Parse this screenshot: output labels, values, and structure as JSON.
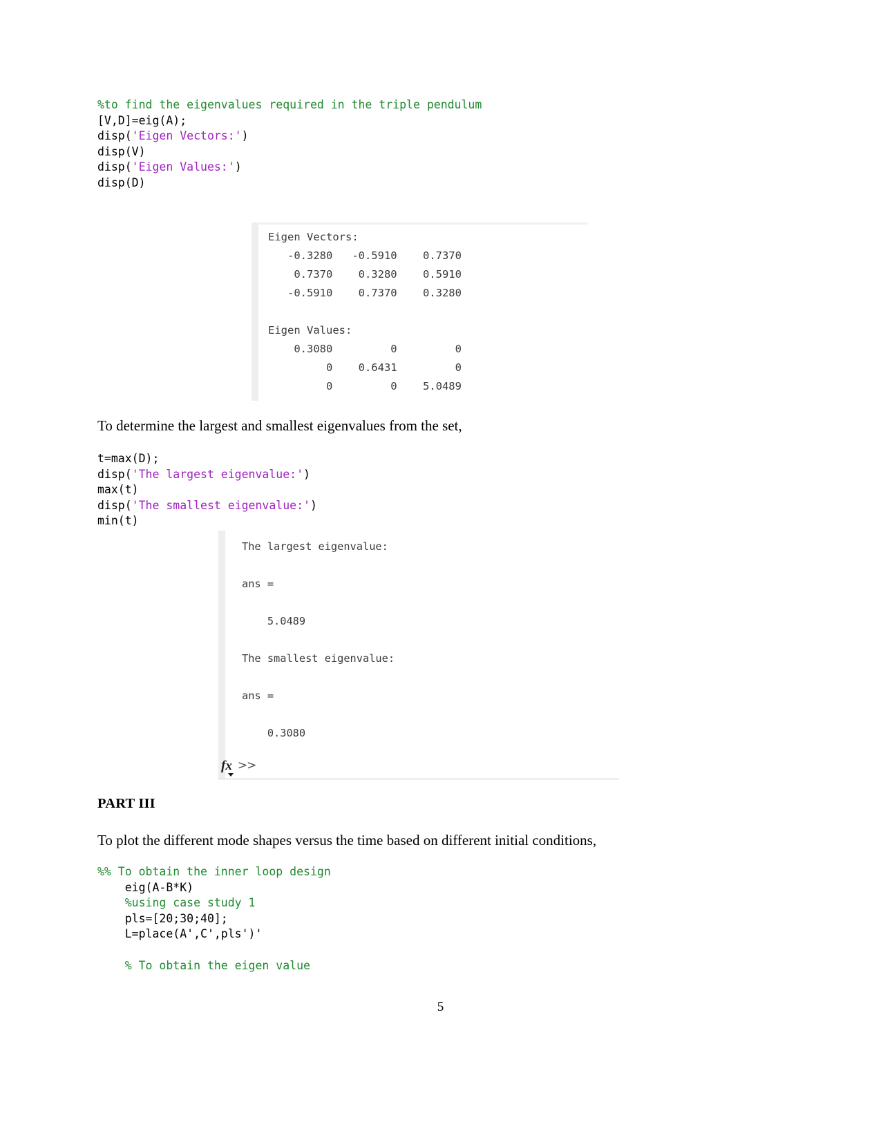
{
  "document": {
    "page_number": "5",
    "section_heading": "PART III"
  },
  "code_block_1": {
    "name": "matlab-eig-code",
    "lines": [
      {
        "segments": [
          {
            "kind": "cmt",
            "text": "%to find the eigenvalues required in the triple pendulum"
          }
        ]
      },
      {
        "segments": [
          {
            "kind": "pln",
            "text": "[V,D]=eig(A);"
          }
        ]
      },
      {
        "segments": [
          {
            "kind": "pln",
            "text": "disp("
          },
          {
            "kind": "str",
            "text": "'Eigen Vectors:'"
          },
          {
            "kind": "pln",
            "text": ")"
          }
        ]
      },
      {
        "segments": [
          {
            "kind": "pln",
            "text": "disp(V)"
          }
        ]
      },
      {
        "segments": [
          {
            "kind": "pln",
            "text": "disp("
          },
          {
            "kind": "str",
            "text": "'Eigen Values:'"
          },
          {
            "kind": "pln",
            "text": ")"
          }
        ]
      },
      {
        "segments": [
          {
            "kind": "pln",
            "text": "disp(D)"
          }
        ]
      }
    ]
  },
  "console_1": {
    "name": "matlab-output-eigen",
    "lines": [
      "Eigen Vectors:",
      "   -0.3280   -0.5910    0.7370",
      "    0.7370    0.3280    0.5910",
      "   -0.5910    0.7370    0.3280",
      "",
      "Eigen Values:",
      "    0.3080         0         0",
      "         0    0.6431         0",
      "         0         0    5.0489"
    ],
    "eigen_vectors_label": "Eigen Vectors:",
    "eigen_vectors_matrix": [
      [
        "-0.3280",
        "-0.5910",
        "0.7370"
      ],
      [
        "0.7370",
        "0.3280",
        "0.5910"
      ],
      [
        "-0.5910",
        "0.7370",
        "0.3280"
      ]
    ],
    "eigen_values_label": "Eigen Values:",
    "eigen_values_matrix": [
      [
        "0.3080",
        "0",
        "0"
      ],
      [
        "0",
        "0.6431",
        "0"
      ],
      [
        "0",
        "0",
        "5.0489"
      ]
    ]
  },
  "paragraph_1": {
    "text": "To determine the largest and smallest eigenvalues from the set,"
  },
  "code_block_2": {
    "name": "matlab-minmax-code",
    "lines": [
      {
        "segments": [
          {
            "kind": "pln",
            "text": "t=max(D);"
          }
        ]
      },
      {
        "segments": [
          {
            "kind": "pln",
            "text": "disp("
          },
          {
            "kind": "str",
            "text": "'The largest eigenvalue:'"
          },
          {
            "kind": "pln",
            "text": ")"
          }
        ]
      },
      {
        "segments": [
          {
            "kind": "pln",
            "text": "max(t)"
          }
        ]
      },
      {
        "segments": [
          {
            "kind": "pln",
            "text": "disp("
          },
          {
            "kind": "str",
            "text": "'The smallest eigenvalue:'"
          },
          {
            "kind": "pln",
            "text": ")"
          }
        ]
      },
      {
        "segments": [
          {
            "kind": "pln",
            "text": "min(t)"
          }
        ]
      }
    ]
  },
  "console_2": {
    "name": "matlab-output-minmax",
    "lines": [
      "The largest eigenvalue:",
      "",
      "ans =",
      "",
      "    5.0489",
      "",
      "The smallest eigenvalue:",
      "",
      "ans =",
      "",
      "    0.3080"
    ],
    "largest_label": "The largest eigenvalue:",
    "largest_ans_label": "ans =",
    "largest_value": "5.0489",
    "smallest_label": "The smallest eigenvalue:",
    "smallest_ans_label": "ans =",
    "smallest_value": "0.3080",
    "prompt": ">>",
    "fx_label": "fx"
  },
  "paragraph_2": {
    "text": "To plot the different mode shapes versus the time based on different initial conditions,"
  },
  "code_block_3": {
    "name": "matlab-inner-loop-code",
    "lines": [
      {
        "segments": [
          {
            "kind": "cmt",
            "text": "%% To obtain the inner loop design"
          }
        ]
      },
      {
        "segments": [
          {
            "kind": "pln",
            "text": "    eig(A-B*K)"
          }
        ]
      },
      {
        "segments": [
          {
            "kind": "cmt",
            "text": "    %using case study 1"
          }
        ]
      },
      {
        "segments": [
          {
            "kind": "pln",
            "text": "    pls=[20;30;40];"
          }
        ]
      },
      {
        "segments": [
          {
            "kind": "pln",
            "text": "    L=place(A',C',pls')'"
          }
        ]
      },
      {
        "segments": [
          {
            "kind": "pln",
            "text": ""
          }
        ]
      },
      {
        "segments": [
          {
            "kind": "cmt",
            "text": "    % To obtain the eigen value"
          }
        ]
      }
    ]
  },
  "colors": {
    "comment_green": "#1f8a2f",
    "string_purple": "#a020c0",
    "console_text": "#3b3b3b",
    "gutter_gray": "#eeeeee"
  }
}
